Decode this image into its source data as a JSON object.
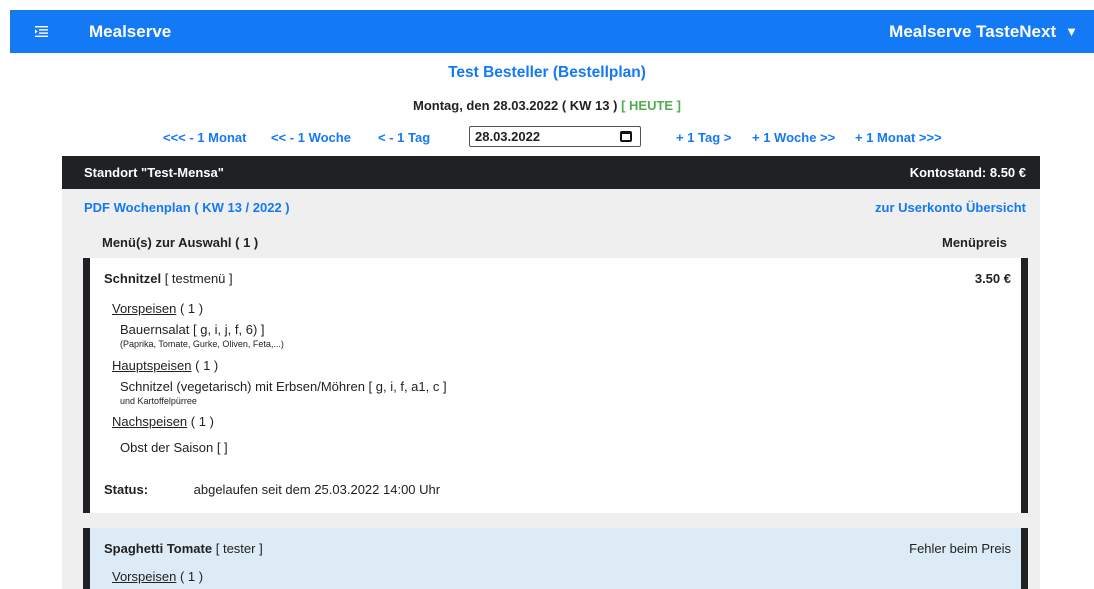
{
  "topbar": {
    "brand": "Mealserve",
    "tenant": "Mealserve TasteNext",
    "menu_icon": "menu-list-icon",
    "caret_icon": "caret-down-icon"
  },
  "title": "Test Besteller (Bestellplan)",
  "dateline": {
    "text": "Montag, den 28.03.2022 ( KW 13 )",
    "today": "[ HEUTE ]"
  },
  "nav": {
    "back_month": "<<< - 1 Monat",
    "back_week": "<< - 1 Woche",
    "back_day": "< - 1 Tag",
    "date_value": "28.03.2022",
    "fwd_day": "+ 1 Tag >",
    "fwd_week": "+ 1 Woche >>",
    "fwd_month": "+ 1 Monat >>>"
  },
  "location": {
    "name": "Standort \"Test-Mensa\"",
    "balance": "Kontostand: 8.50 €"
  },
  "links": {
    "pdf": "PDF Wochenplan ( KW 13 / 2022 )",
    "account": "zur Userkonto Übersicht"
  },
  "columns": {
    "menus": "Menü(s) zur Auswahl ( 1 )",
    "price": "Menüpreis"
  },
  "menus": [
    {
      "name": "Schnitzel",
      "tag": "[ testmenü ]",
      "price": "3.50 €",
      "sections": [
        {
          "label": "Vorspeisen",
          "count": "( 1 )",
          "dish": "Bauernsalat [ g, i, j, f, 6) ]",
          "note": "(Paprika, Tomate, Gurke, Oliven, Feta,...)"
        },
        {
          "label": "Hauptspeisen",
          "count": "( 1 )",
          "dish": "Schnitzel (vegetarisch) mit Erbsen/Möhren [ g, i, f, a1, c ]",
          "note": "und Kartoffelpürree"
        },
        {
          "label": "Nachspeisen",
          "count": "( 1 )",
          "dish": "Obst der Saison [ ]",
          "note": ""
        }
      ],
      "status_label": "Status:",
      "status_value": "abgelaufen seit dem 25.03.2022 14:00 Uhr"
    },
    {
      "name": "Spaghetti Tomate",
      "tag": "[ tester ]",
      "price": "Fehler beim Preis",
      "sections": [
        {
          "label": "Vorspeisen",
          "count": "( 1 )"
        }
      ]
    }
  ],
  "colors": {
    "accent": "#1479f5",
    "today": "#4cae4c",
    "dark": "#202124",
    "panel": "#efefef",
    "highlight": "#dcebf6"
  }
}
